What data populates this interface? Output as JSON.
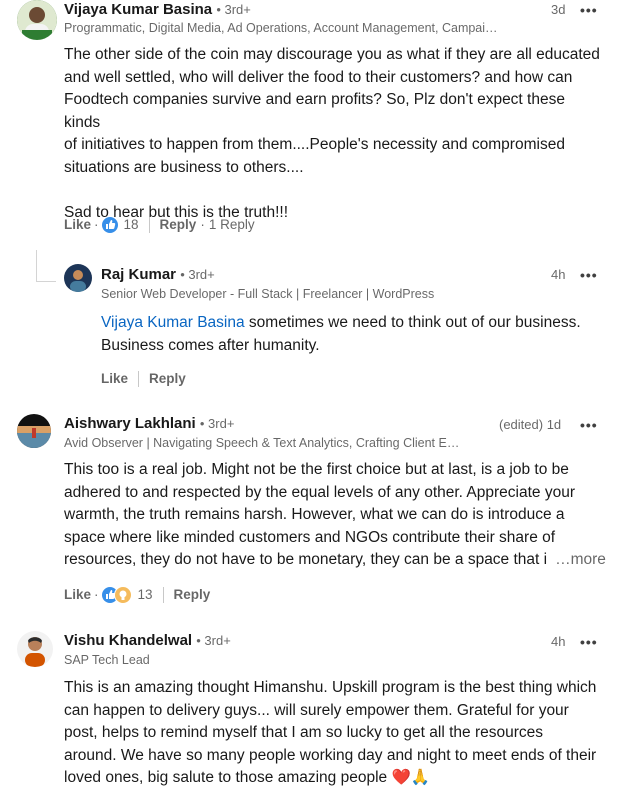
{
  "comments": [
    {
      "author": "Vijaya Kumar Basina",
      "degree": "• 3rd+",
      "headline": "Programmatic, Digital Media, Ad Operations, Account Management, Campai…",
      "time": "3d",
      "body_lines": [
        "The other side of the coin may discourage you as what if they are all educated",
        "and well settled, who will deliver the food to their customers? and how can",
        "Foodtech companies survive and earn profits? So, Plz don't expect these kinds",
        "of initiatives to happen from them....People's necessity and compromised",
        "situations are business to others....",
        "",
        "Sad to hear but this is the truth!!!"
      ],
      "like_label": "Like",
      "reaction_count": "18",
      "reply_label": "Reply",
      "replies_label": "1 Reply"
    },
    {
      "author": "Raj Kumar",
      "degree": "• 3rd+",
      "headline": "Senior Web Developer - Full Stack | Freelancer | WordPress",
      "time": "4h",
      "mention": "Vijaya Kumar Basina",
      "body_rest_1": " sometimes we need to think out of our business.",
      "body_line_2": "Business comes after humanity.",
      "like_label": "Like",
      "reply_label": "Reply"
    },
    {
      "author": "Aishwary Lakhlani",
      "degree": "• 3rd+",
      "headline": "Avid Observer | Navigating Speech & Text Analytics, Crafting Client E…",
      "time": "(edited) 1d",
      "body_lines": [
        "This too is a real job. Might not be the first choice but at last, is a job to be",
        "adhered to and respected by the equal levels of any other. Appreciate your",
        "warmth, the truth remains harsh. However, what we can do is introduce a",
        "space where like minded customers and NGOs contribute their share of",
        "resources, they do not have to be monetary, they can be a space that i"
      ],
      "more_label": "…more",
      "like_label": "Like",
      "reaction_count": "13",
      "reply_label": "Reply"
    },
    {
      "author": "Vishu Khandelwal",
      "degree": "• 3rd+",
      "headline": "SAP Tech Lead",
      "time": "4h",
      "body_lines": [
        "This is an amazing thought Himanshu. Upskill program is the best thing which",
        "can happen to delivery guys... will surely empower them. Grateful for your",
        "post, helps to remind myself that I am so lucky to get all the resources",
        "around. We have so many people working day and night to meet ends of their",
        "loved ones, big salute to those amazing people"
      ],
      "emoji": "❤️🙏"
    }
  ],
  "more_icon": "three-dots-horizontal",
  "colors": {
    "link": "#0a66c2",
    "like_blue": "#378fe9",
    "celebrate_green": "#44712e",
    "support_yellow": "#f5bb5c"
  }
}
